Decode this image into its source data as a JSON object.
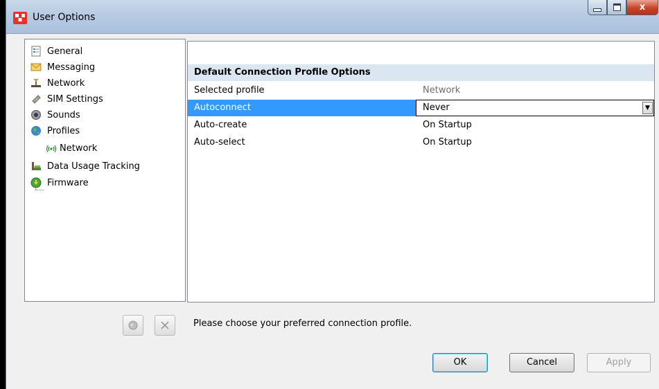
{
  "window": {
    "title": "User Options",
    "controls": {
      "minimize": "–",
      "maximize": "□",
      "close": "x"
    }
  },
  "tree": {
    "items": [
      {
        "label": "General",
        "icon": "general-icon"
      },
      {
        "label": "Messaging",
        "icon": "envelope-icon"
      },
      {
        "label": "Network",
        "icon": "network-icon"
      },
      {
        "label": "SIM Settings",
        "icon": "sim-icon"
      },
      {
        "label": "Sounds",
        "icon": "speaker-icon"
      },
      {
        "label": "Profiles",
        "icon": "globe-icon"
      },
      {
        "label": "Network",
        "icon": "signal-icon",
        "child": true
      },
      {
        "label": "Data Usage Tracking",
        "icon": "chart-icon"
      },
      {
        "label": "Firmware",
        "icon": "download-icon"
      }
    ]
  },
  "panel": {
    "section_title": "Default Connection Profile Options",
    "rows": [
      {
        "name": "Selected profile",
        "value": "Network"
      },
      {
        "name": "Autoconnect",
        "value": "Never"
      },
      {
        "name": "Auto-create",
        "value": "On Startup"
      },
      {
        "name": "Auto-select",
        "value": "On Startup"
      }
    ]
  },
  "hint": "Please choose your preferred connection profile.",
  "buttons": {
    "ok": "OK",
    "cancel": "Cancel",
    "apply": "Apply"
  },
  "colors": {
    "selection": "#3399ff",
    "section_header": "#dbe6f3",
    "titlebar": "#b7cbe3"
  }
}
